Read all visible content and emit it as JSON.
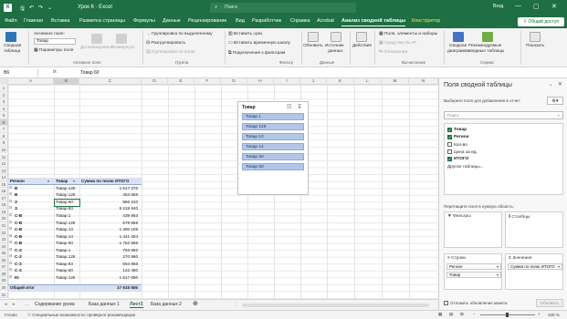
{
  "title_bar": {
    "app_icon": "X",
    "autosave_label": "Автосохранение",
    "title": "Урок 6  ·  Excel",
    "search_placeholder": "Поиск",
    "login": "Вход",
    "window_controls": [
      "—",
      "▢",
      "✕"
    ]
  },
  "tabs": [
    "Файл",
    "Главная",
    "Вставка",
    "Разметка страницы",
    "Формулы",
    "Данные",
    "Рецензирование",
    "Вид",
    "Разработчик",
    "Справка",
    "Acrobat",
    "Анализ сводной таблицы",
    "Конструктор"
  ],
  "active_tab": "Анализ сводной таблицы",
  "share_label": "Общий доступ",
  "ribbon": {
    "pivot_label_1": "Сводная",
    "pivot_label_2": "таблица",
    "active_field_label": "Активное поле:",
    "active_field_value": "Товар",
    "field_params": "Параметры поля",
    "drill_down": "Детализировать",
    "drill_up": "Развернуть",
    "group_active": "Активное поле",
    "group_selection": "Группировка по выделенному",
    "ungroup": "Разгруппировать",
    "group_field": "Группировка по полю",
    "group_group": "Группа",
    "insert_slicer": "Вставить срез",
    "insert_timeline": "Вставить временную шкалу",
    "filter_connections": "Подключения к фильтрам",
    "group_filter": "Фильтр",
    "refresh": "Обновить",
    "change_source_1": "Источник",
    "change_source_2": "данных",
    "group_data": "Данные",
    "actions": "Действия",
    "fields_items": "Поля, элементы и наборы",
    "olap": "Средства OLAP",
    "relations": "Отношения",
    "group_calc": "Вычисления",
    "pivot_chart_1": "Сводная",
    "pivot_chart_2": "диаграмма",
    "recommended_1": "Рекомендуемые",
    "recommended_2": "сводные таблицы",
    "group_service": "Сервис",
    "show": "Показать"
  },
  "formula_bar": {
    "cell_ref": "B6",
    "fx": "fx",
    "value": "Товар 60"
  },
  "columns": [
    "A",
    "B",
    "C",
    "D",
    "E",
    "F",
    "G",
    "H",
    "I",
    "J",
    "K",
    "L",
    "M",
    "N"
  ],
  "pivot_table": {
    "header": [
      "Регион",
      "Товар",
      "Сумма по полю ИТОГО"
    ],
    "rows": [
      [
        "В",
        "Товар 128",
        "1 517 376"
      ],
      [
        "В",
        "Товар 128",
        "453 858"
      ],
      [
        "З",
        "Товар 60",
        "966 310"
      ],
      [
        "З",
        "Товар 83",
        "5 219 940"
      ],
      [
        "С-В",
        "Товар 1",
        "439 953"
      ],
      [
        "С-В",
        "Товар 128",
        "679 658"
      ],
      [
        "С-В",
        "Товар 13",
        "1 280 109"
      ],
      [
        "С-В",
        "Товар 14",
        "1 441 404"
      ],
      [
        "С-В",
        "Товар 60",
        "1 752 968"
      ],
      [
        "С-З",
        "Товар 1",
        "763 692"
      ],
      [
        "С-З",
        "Товар 128",
        "270 960"
      ],
      [
        "С-З",
        "Товар 83",
        "594 968"
      ],
      [
        "С-З",
        "Товар 60",
        "122 490"
      ],
      [
        "Ю",
        "Товар 128",
        "1 817 690"
      ]
    ],
    "total_label": "Общий итог",
    "total_value": "17 615 506"
  },
  "slicer": {
    "title": "Товар",
    "items": [
      "Товар 1",
      "Товар 128",
      "Товар 13",
      "Товар 14",
      "Товар 60",
      "Товар 83"
    ]
  },
  "sheet_tabs": [
    "Содержание урока",
    "База данных 1",
    "Лист3",
    "База данных 2"
  ],
  "active_sheet": "Лист3",
  "status": {
    "ready": "Готово",
    "accessibility": "Специальные возможности: проверьте рекомендации",
    "zoom": "100 %"
  },
  "pane": {
    "title": "Поля сводной таблицы",
    "subtitle": "Выберите поля для добавления в отчет:",
    "search_placeholder": "Поиск",
    "fields": [
      {
        "name": "Товар",
        "checked": true
      },
      {
        "name": "Регион",
        "checked": true
      },
      {
        "name": "Кол-во",
        "checked": false
      },
      {
        "name": "Цена за ед.",
        "checked": false
      },
      {
        "name": "ИТОГО",
        "checked": true
      }
    ],
    "more_tables": "Другие таблицы...",
    "drag_hint": "Перетащите поля в нужную область:",
    "filters": "Фильтры",
    "columns": "Столбцы",
    "rows": "Строки",
    "values": "Значения",
    "rows_items": [
      "Регион",
      "Товар"
    ],
    "values_items": [
      "Сумма по полю ИТОГО"
    ],
    "defer": "Отложить обновление макета",
    "update": "Обновить"
  },
  "colors": {
    "accent": "#1e6f43",
    "pivot_header": "#d9e1f2",
    "slicer_item": "#b4c6e7"
  }
}
